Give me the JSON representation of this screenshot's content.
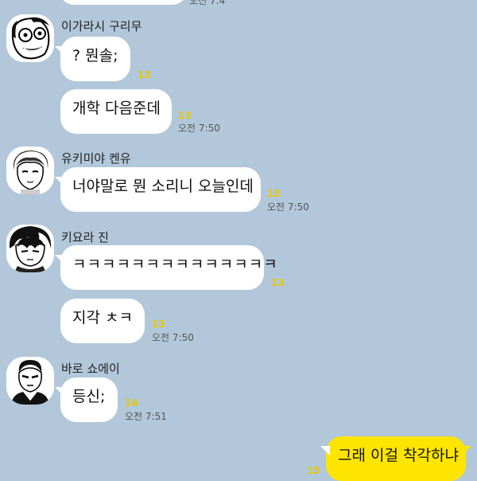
{
  "top_time_partial": "오전 7:4",
  "messages": [
    {
      "sender": "이가라시 구리무",
      "text": "? 뭔솔;",
      "read_count": "13"
    },
    {
      "text": "개학 다음준데",
      "read_count": "13",
      "time": "오전 7:50"
    },
    {
      "sender": "유키미야 켄유",
      "text": "너야말로 뭔 소리니 오늘인데",
      "read_count": "13",
      "time": "오전 7:50"
    },
    {
      "sender": "키요라 진",
      "text": "ㅋㅋㅋㅋㅋㅋㅋㅋㅋㅋㅋㅋㅋㅋ",
      "read_count": "13"
    },
    {
      "text": "지각 ㅊㅋ",
      "read_count": "13",
      "time": "오전 7:50"
    },
    {
      "sender": "바로 쇼에이",
      "text": "등신;",
      "read_count": "14",
      "time": "오전 7:51"
    },
    {
      "text": "그래 이걸 착각하냐",
      "read_count": "15",
      "mine": true
    }
  ],
  "colors": {
    "background": "#b2c7d9",
    "my_bubble": "#fee500",
    "other_bubble": "#ffffff",
    "read_count": "#e8c800"
  }
}
